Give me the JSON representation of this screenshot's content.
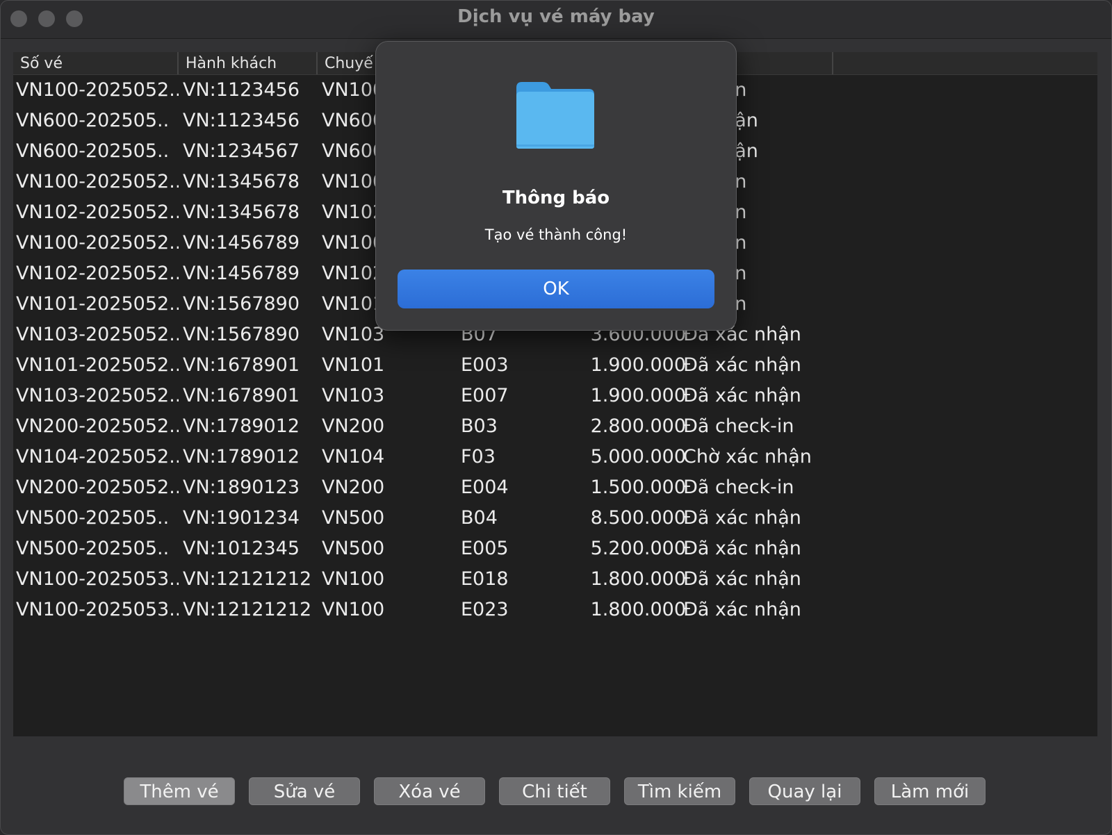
{
  "window": {
    "title": "Dịch vụ vé máy bay"
  },
  "table": {
    "headers": [
      "Số vé",
      "Hành khách",
      "Chuyế",
      "",
      "",
      "thái",
      ""
    ],
    "rows": [
      [
        "VN100-2025052..",
        "VN:1123456",
        "VN100",
        "",
        "",
        "c nhận"
      ],
      [
        "VN600-202505..",
        "VN:1123456",
        "VN600",
        "",
        "",
        "ác nhận"
      ],
      [
        "VN600-202505..",
        "VN:1234567",
        "VN600",
        "",
        "",
        "ác nhận"
      ],
      [
        "VN100-2025052..",
        "VN:1345678",
        "VN100",
        "",
        "",
        "c nhận"
      ],
      [
        "VN102-2025052..",
        "VN:1345678",
        "VN102",
        "",
        "",
        "c nhận"
      ],
      [
        "VN100-2025052..",
        "VN:1456789",
        "VN100",
        "",
        "",
        "c nhận"
      ],
      [
        "VN102-2025052..",
        "VN:1456789",
        "VN102",
        "",
        "",
        "c nhận"
      ],
      [
        "VN101-2025052..",
        "VN:1567890",
        "VN101",
        "",
        "",
        "c nhận"
      ],
      [
        "VN103-2025052..",
        "VN:1567890",
        "VN103",
        "B07",
        "3.600.000",
        "Đã xác nhận"
      ],
      [
        "VN101-2025052..",
        "VN:1678901",
        "VN101",
        "E003",
        "1.900.000",
        "Đã xác nhận"
      ],
      [
        "VN103-2025052..",
        "VN:1678901",
        "VN103",
        "E007",
        "1.900.000",
        "Đã xác nhận"
      ],
      [
        "VN200-2025052..",
        "VN:1789012",
        "VN200",
        "B03",
        "2.800.000",
        "Đã check-in"
      ],
      [
        "VN104-2025052..",
        "VN:1789012",
        "VN104",
        "F03",
        "5.000.000",
        "Chờ xác nhận"
      ],
      [
        "VN200-2025052..",
        "VN:1890123",
        "VN200",
        "E004",
        "1.500.000",
        "Đã check-in"
      ],
      [
        "VN500-202505..",
        "VN:1901234",
        "VN500",
        "B04",
        "8.500.000",
        "Đã xác nhận"
      ],
      [
        "VN500-202505..",
        "VN:1012345",
        "VN500",
        "E005",
        "5.200.000",
        "Đã xác nhận"
      ],
      [
        "VN100-2025053..",
        "VN:12121212",
        "VN100",
        "E018",
        "1.800.000",
        "Đã xác nhận"
      ],
      [
        "VN100-2025053..",
        "VN:12121212",
        "VN100",
        "E023",
        "1.800.000",
        "Đã xác nhận"
      ]
    ]
  },
  "buttons": [
    "Thêm vé",
    "Sửa vé",
    "Xóa vé",
    "Chi tiết",
    "Tìm kiếm",
    "Quay lại",
    "Làm mới"
  ],
  "dialog": {
    "icon": "folder-icon",
    "title": "Thông báo",
    "message": "Tạo vé thành công!",
    "ok_label": "OK"
  },
  "colors": {
    "accent": "#2f74de",
    "folder": "#5ab8f0"
  }
}
